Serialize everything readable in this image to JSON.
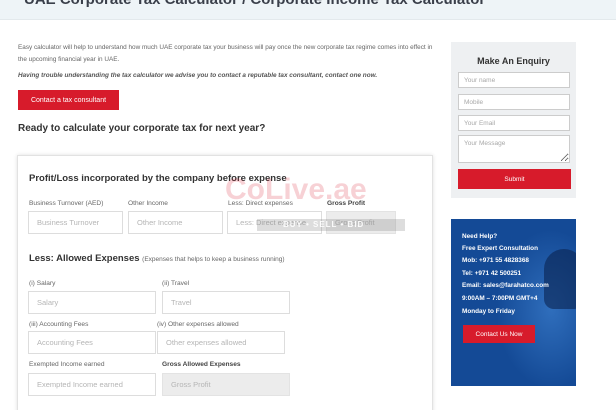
{
  "page": {
    "title": "UAE Corporate Tax Calculator / Corporate Income Tax Calculator",
    "intro": "Easy calculator will help to understand how much UAE corporate tax your business will pay once the new corporate tax regime comes into effect in the upcoming financial year in UAE.",
    "intro_bold": "Having trouble understanding the tax calculator we advise you to contact a reputable tax consultant, contact one now.",
    "consultant_button": "Contact a tax consultant",
    "ready_heading": "Ready to calculate your corporate tax for next year?"
  },
  "calculator": {
    "section1_title": "Profit/Loss incorporated by the company before expense",
    "business_turnover": {
      "label": "Business Turnover (AED)",
      "placeholder": "Business Turnover"
    },
    "other_income": {
      "label": "Other Income",
      "placeholder": "Other Income"
    },
    "direct_expenses": {
      "label": "Less: Direct expenses",
      "placeholder": "Less: Direct expense"
    },
    "gross_profit": {
      "label": "Gross Profit",
      "placeholder": "Gross Profit"
    },
    "section2_title": "Less: Allowed Expenses",
    "section2_note": "(Expenses that helps to keep a business running)",
    "salary": {
      "label": "(i) Salary",
      "placeholder": "Salary"
    },
    "travel": {
      "label": "(ii) Travel",
      "placeholder": "Travel"
    },
    "accounting": {
      "label": "(iii) Accounting Fees",
      "placeholder": "Accounting Fees"
    },
    "other_expenses": {
      "label": "(iv) Other expenses allowed",
      "placeholder": "Other expenses allowed"
    },
    "exempted": {
      "label": "Exempted Income earned",
      "placeholder": "Exempted Income earned"
    },
    "gross_allowed": {
      "label": "Gross Allowed Expenses",
      "placeholder": "Gross Profit"
    }
  },
  "watermark": {
    "logo": "CoLive.ae",
    "strip": "BUY • SELL • BID"
  },
  "enquiry": {
    "title": "Make An Enquiry",
    "name_placeholder": "Your name",
    "mobile_placeholder": "Mobile",
    "email_placeholder": "Your Email",
    "message_placeholder": "Your Message",
    "submit_label": "Submit"
  },
  "help": {
    "lines": [
      "Need Help?",
      "Free Expert Consultation",
      "Mob: +971 55 4828368",
      "Tel: +971 42 500251",
      "Email: sales@farahatco.com",
      "9:00AM – 7:00PM GMT+4",
      "Monday to Friday"
    ],
    "contact_button": "Contact Us Now"
  },
  "colors": {
    "accent_red": "#d71b2b",
    "help_blue": "#144a96"
  }
}
